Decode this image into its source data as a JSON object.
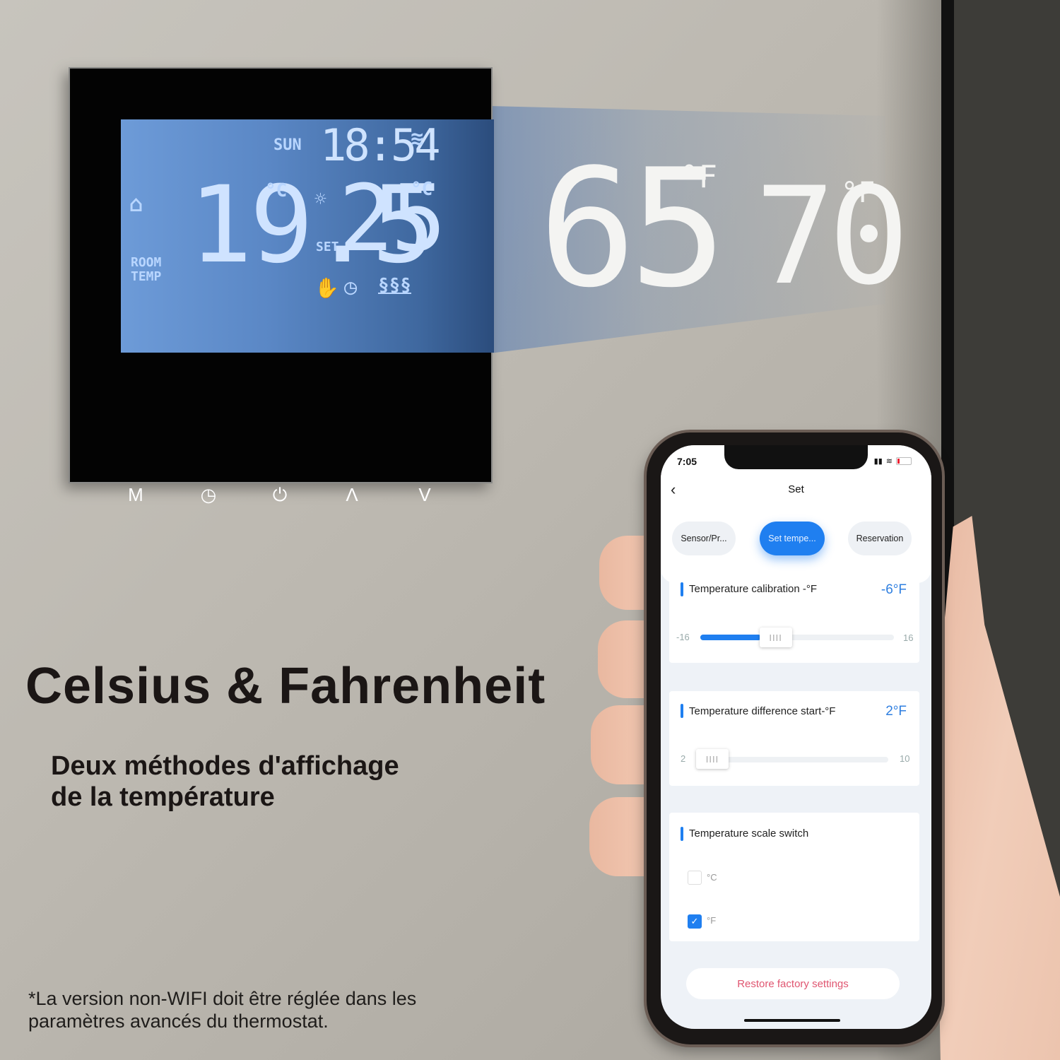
{
  "thermostat": {
    "day": "SUN",
    "time": "18:54",
    "room_temp": "19.5",
    "room_unit": "°C",
    "room_label_1": "ROOM",
    "room_label_2": "TEMP",
    "set_label": "SET",
    "set_temp": "25",
    "set_unit": "°C",
    "icons": [
      "wifi-icon",
      "home-thermometer-icon",
      "sun-icon",
      "hand-icon",
      "clock-icon",
      "floor-heating-icon"
    ],
    "buttons": [
      {
        "name": "mode-button",
        "glyph": "M"
      },
      {
        "name": "timer-button",
        "glyph": "◷"
      },
      {
        "name": "power-button",
        "glyph": "⏻"
      },
      {
        "name": "up-button",
        "glyph": "Λ"
      },
      {
        "name": "down-button",
        "glyph": "V"
      }
    ]
  },
  "projection": {
    "room_temp_f": "65",
    "set_temp_f": "70",
    "unit": "°F"
  },
  "headline": "Celsius & Fahrenheit",
  "subheadline_1": "Deux méthodes d'affichage",
  "subheadline_2": "de la température",
  "footnote_1": "*La version non-WIFI doit être réglée dans les",
  "footnote_2": "paramètres avancés du thermostat.",
  "app": {
    "status_time": "7:05",
    "title": "Set",
    "back_glyph": "‹",
    "tabs": [
      {
        "label": "Sensor/Pr...",
        "active": false
      },
      {
        "label": "Set tempe...",
        "active": true
      },
      {
        "label": "Reservation",
        "active": false
      }
    ],
    "calibration": {
      "label": "Temperature calibration -°F",
      "value": "-6°F",
      "min": "-16",
      "max": "16",
      "current": -6
    },
    "difference": {
      "label": "Temperature difference start-°F",
      "value": "2°F",
      "min": "2",
      "max": "10",
      "current": 2
    },
    "scale": {
      "label": "Temperature scale switch",
      "options": [
        {
          "label": "°C",
          "checked": false
        },
        {
          "label": "°F",
          "checked": true
        }
      ]
    },
    "restore_label": "Restore factory settings",
    "slider_grip": "IIII",
    "accent_color": "#1f7ff0",
    "danger_color": "#e05570"
  }
}
